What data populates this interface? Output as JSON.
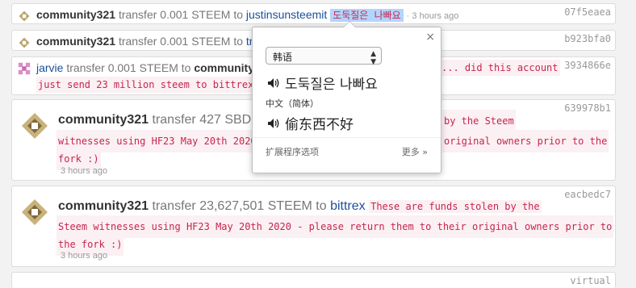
{
  "rows": [
    {
      "author": "community321",
      "action": "transfer 0.001 STEEM to",
      "to": "justinsunsteemit",
      "memo": "도둑질은 나빠요",
      "time": "· 3 hours ago",
      "hash": "07f5eaea"
    },
    {
      "author": "community321",
      "action": "transfer 0.001 STEEM to",
      "to": "triple",
      "hash": "b923bfa0"
    },
    {
      "author": "jarvie",
      "action": "transfer 0.001 STEEM to",
      "to": "community321",
      "memo1": "... did this account",
      "memo2": "just send 23 million steem to bittrex",
      "hash": "3934866e"
    },
    {
      "author": "community321",
      "action": "transfer 427 SBD",
      "memo1": "by the Steem",
      "memo2a": "witnesses using HF23 May 20th 2020",
      "memo2b": "original owners prior to the",
      "memo3": "fork :)",
      "time": "3 hours ago",
      "hash": "639978b1"
    },
    {
      "author": "community321",
      "action": "transfer 23,627,501 STEEM to",
      "to": "bittrex",
      "memo1": "These are funds stolen by the",
      "memo2": "Steem witnesses using HF23 May 20th 2020 - please return them to their original owners prior to",
      "memo3": "the fork :)",
      "time": "3 hours ago",
      "hash": "eacbedc7"
    },
    {
      "hash": "virtual"
    }
  ],
  "popup": {
    "language": "韩语",
    "source": "도둑질은 나빠요",
    "target_lang": "中文（简体）",
    "translation": "偷东西不好",
    "options": "扩展程序选项",
    "more": "更多 »",
    "close": "×"
  },
  "colors": {
    "memo": "#c7254e",
    "link": "#1a5099",
    "highlight": "#b3d4fc"
  }
}
